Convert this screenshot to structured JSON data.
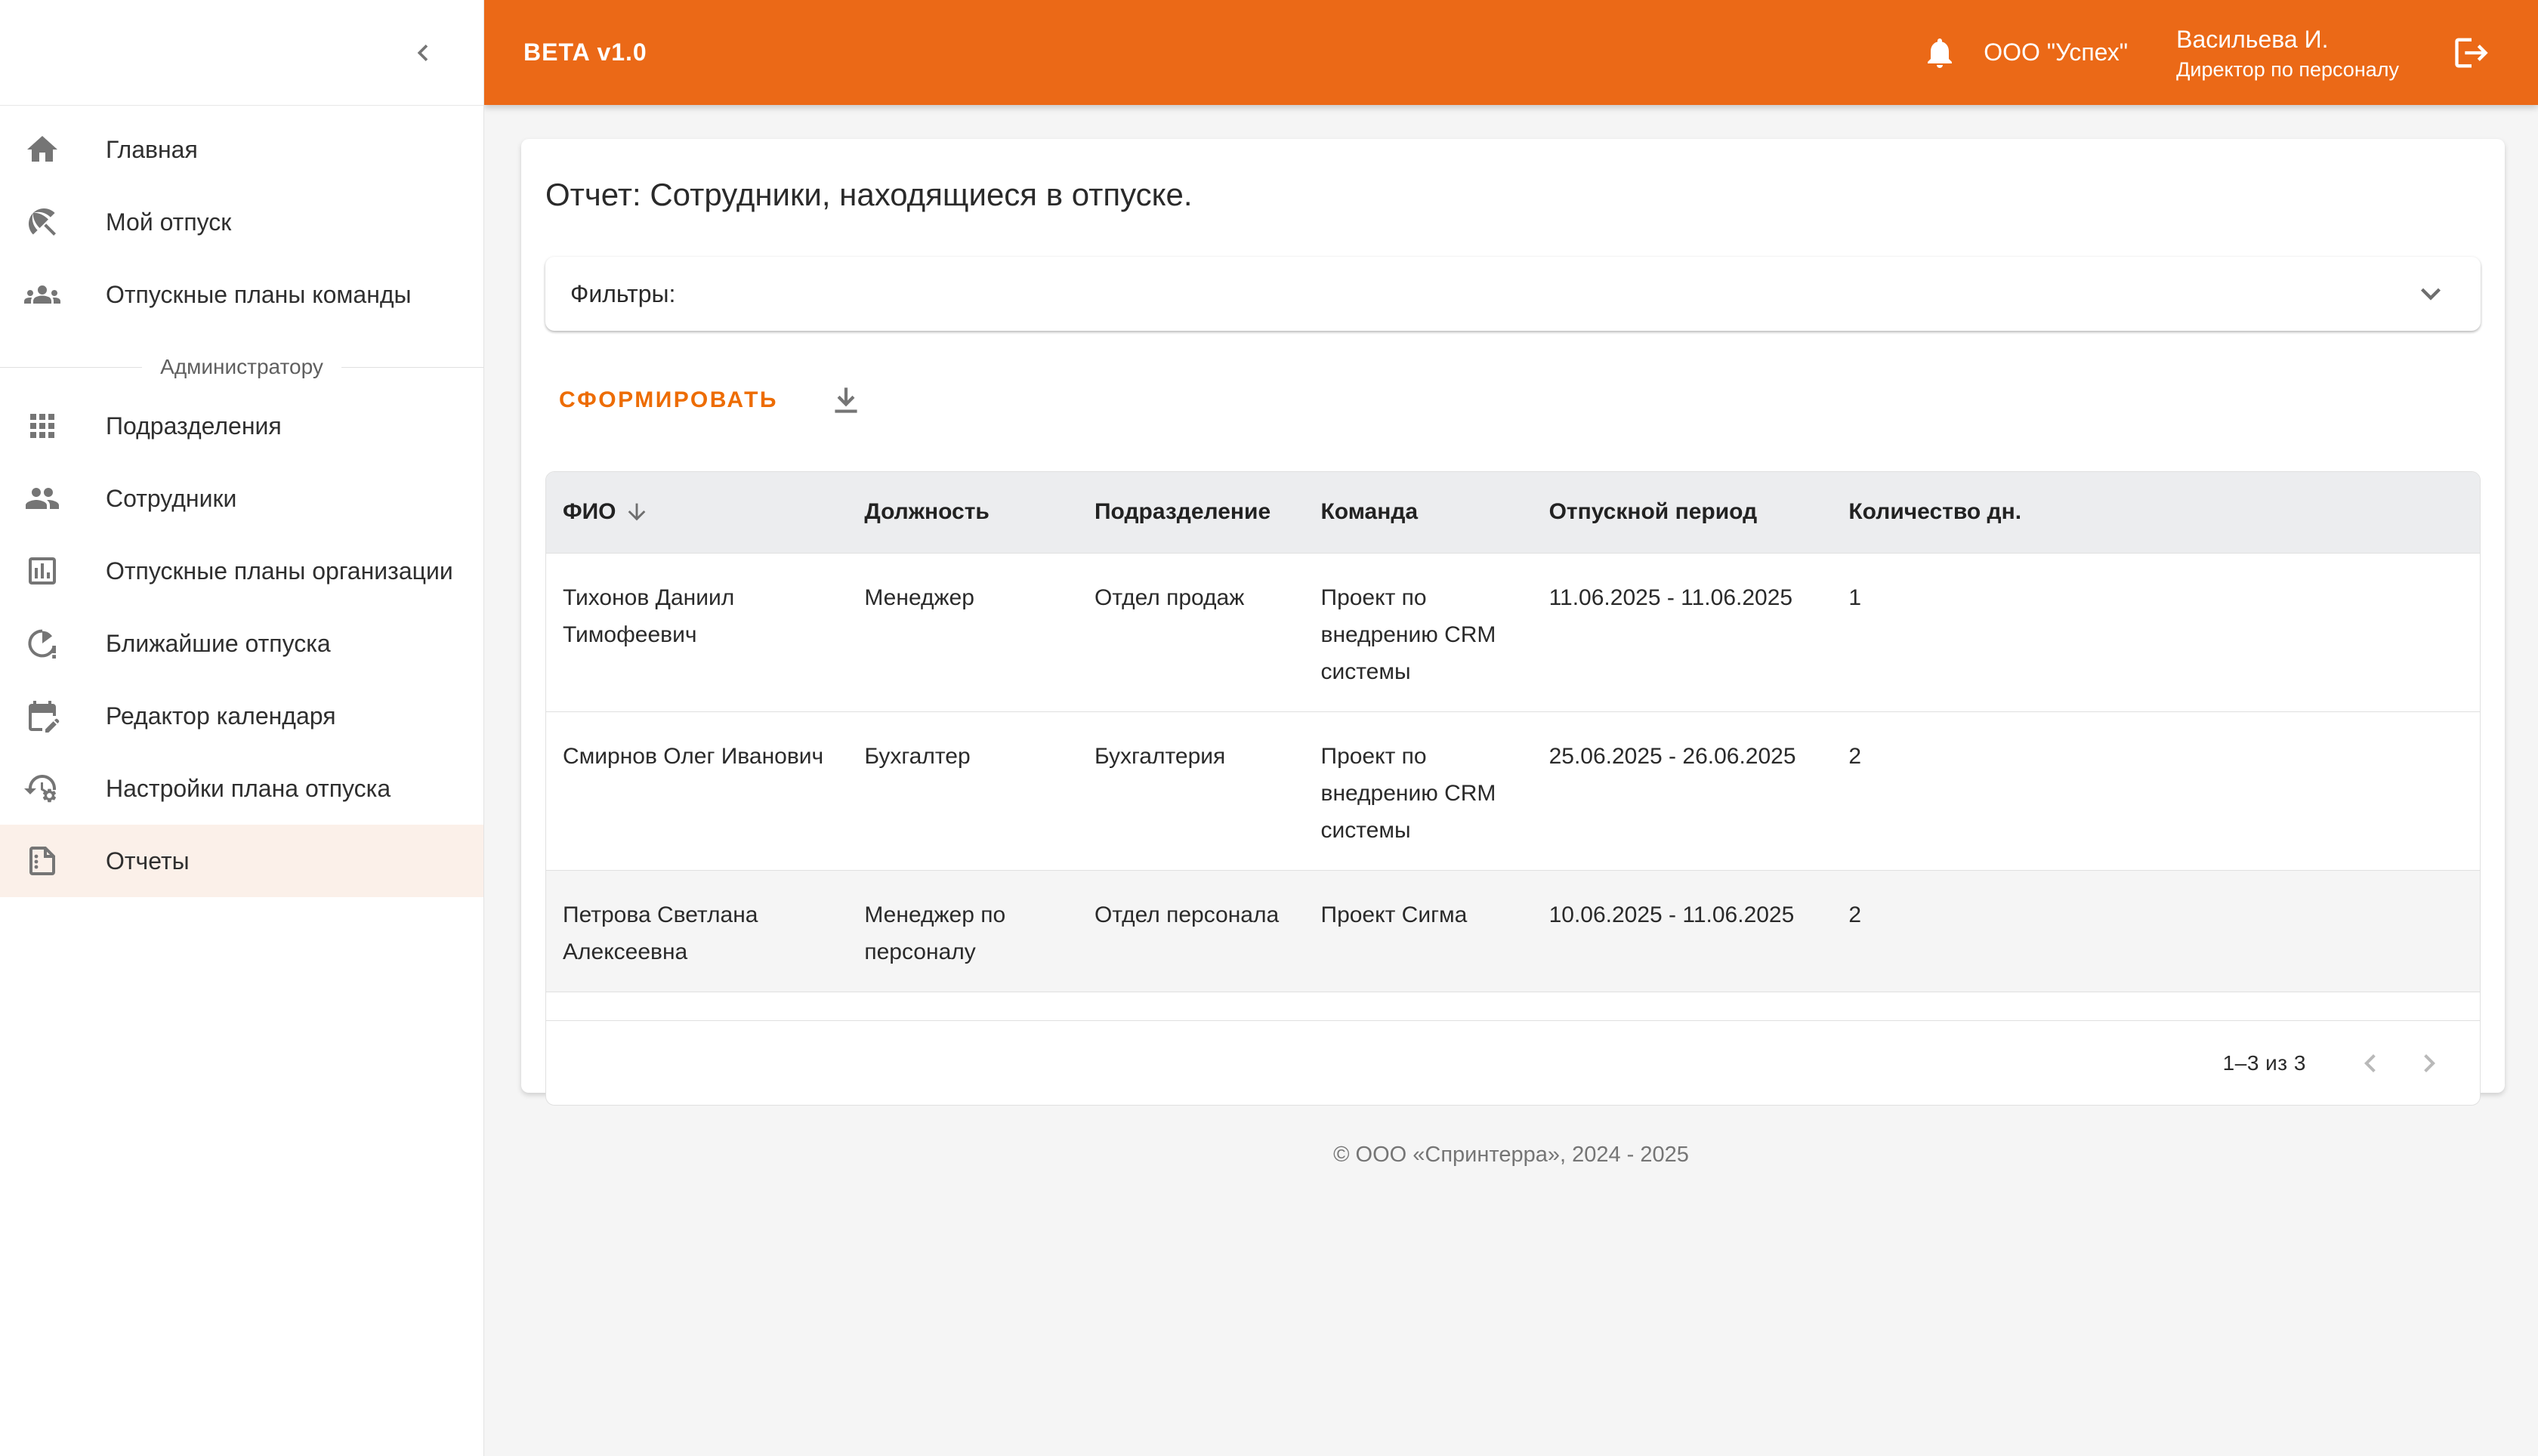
{
  "app": {
    "version_badge": "BETA v1.0",
    "org": "ООО \"Успех\"",
    "user_name": "Васильева И.",
    "user_role": "Директор по персоналу"
  },
  "sidebar": {
    "items_main": [
      {
        "label": "Главная",
        "icon": "home-icon"
      },
      {
        "label": "Мой отпуск",
        "icon": "beach-umbrella-icon"
      },
      {
        "label": "Отпускные планы команды",
        "icon": "groups-icon"
      }
    ],
    "section_label": "Администратору",
    "items_admin": [
      {
        "label": "Подразделения",
        "icon": "grid-icon"
      },
      {
        "label": "Сотрудники",
        "icon": "people-icon"
      },
      {
        "label": "Отпускные планы организации",
        "icon": "bar-chart-icon"
      },
      {
        "label": "Ближайшие отпуска",
        "icon": "upcoming-vacations-icon"
      },
      {
        "label": "Редактор календаря",
        "icon": "calendar-edit-icon"
      },
      {
        "label": "Настройки плана отпуска",
        "icon": "history-settings-icon"
      },
      {
        "label": "Отчеты",
        "icon": "report-file-icon",
        "selected": true
      }
    ]
  },
  "report": {
    "title": "Отчет: Сотрудники, находящиеся в отпуске.",
    "filters_label": "Фильтры:",
    "generate_label": "СФОРМИРОВАТЬ"
  },
  "table": {
    "columns": [
      {
        "label": "ФИО",
        "sorted": "desc"
      },
      {
        "label": "Должность"
      },
      {
        "label": "Подразделение"
      },
      {
        "label": "Команда"
      },
      {
        "label": "Отпускной период"
      },
      {
        "label": "Количество дн."
      }
    ],
    "rows": [
      {
        "fio": "Тихонов Даниил Тимофеевич",
        "position": "Менеджер",
        "department": "Отдел продаж",
        "team": "Проект по внедрению CRM системы",
        "period": "11.06.2025 - 11.06.2025",
        "days": "1"
      },
      {
        "fio": "Смирнов Олег Иванович",
        "position": "Бухгалтер",
        "department": "Бухгалтерия",
        "team": "Проект по внедрению CRM системы",
        "period": "25.06.2025 - 26.06.2025",
        "days": "2"
      },
      {
        "fio": "Петрова Светлана Алексеевна",
        "position": "Менеджер по персоналу",
        "department": "Отдел персонала",
        "team": "Проект Сигма",
        "period": "10.06.2025 - 11.06.2025",
        "days": "2"
      }
    ]
  },
  "pagination": {
    "range_label": "1–3 из 3"
  },
  "footer": {
    "copyright": "© ООО «Спринтерра», 2024 - 2025"
  },
  "colors": {
    "accent_orange": "#EB6917",
    "selected_item_bg": "#FBF0E9",
    "table_header_bg": "#ECEDEF"
  }
}
